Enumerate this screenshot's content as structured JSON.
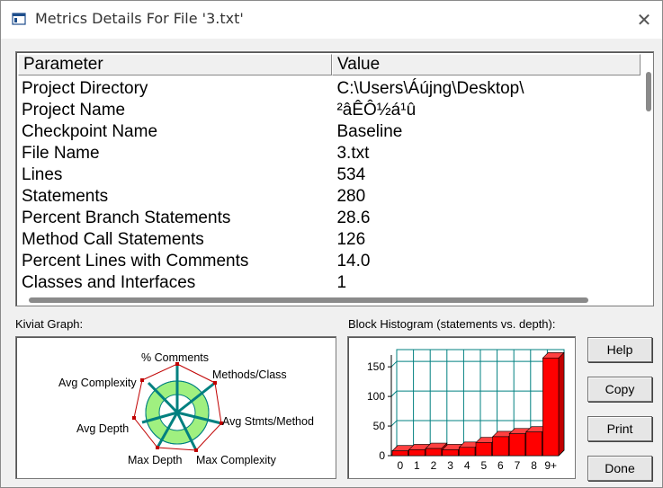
{
  "window": {
    "title": "Metrics Details For File '3.txt'",
    "close_glyph": "✕"
  },
  "table": {
    "headers": [
      "Parameter",
      "Value"
    ],
    "rows": [
      [
        "Project Directory",
        "C:\\Users\\Áújng\\Desktop\\"
      ],
      [
        "Project Name",
        "²âÊÔ½á¹û"
      ],
      [
        "Checkpoint Name",
        "Baseline"
      ],
      [
        "File Name",
        "3.txt"
      ],
      [
        "Lines",
        "534"
      ],
      [
        "Statements",
        "280"
      ],
      [
        "Percent Branch Statements",
        "28.6"
      ],
      [
        "Method Call Statements",
        "126"
      ],
      [
        "Percent Lines with Comments",
        "14.0"
      ],
      [
        "Classes and Interfaces",
        "1"
      ]
    ]
  },
  "kiviat": {
    "label": "Kiviat Graph:",
    "axes": [
      "% Comments",
      "Methods/Class",
      "Avg Stmts/Method",
      "Max Complexity",
      "Max Depth",
      "Avg Depth",
      "Avg Complexity"
    ],
    "colors": {
      "range_fill": "#a0f080",
      "axis": "#008080",
      "polygon": "#c00000"
    }
  },
  "histogram": {
    "label": "Block Histogram (statements vs. depth):",
    "chart_data": {
      "type": "bar",
      "categories": [
        "0",
        "1",
        "2",
        "3",
        "4",
        "5",
        "6",
        "7",
        "8",
        "9+"
      ],
      "values": [
        8,
        10,
        12,
        10,
        14,
        22,
        32,
        37,
        40,
        165
      ],
      "y_ticks": [
        "0",
        "50",
        "100",
        "150"
      ],
      "ylim": [
        0,
        170
      ],
      "grid": true,
      "bar_color": "#ff0000",
      "grid_color": "#008080"
    }
  },
  "buttons": {
    "help": "Help",
    "copy": "Copy",
    "print": "Print",
    "done": "Done"
  }
}
